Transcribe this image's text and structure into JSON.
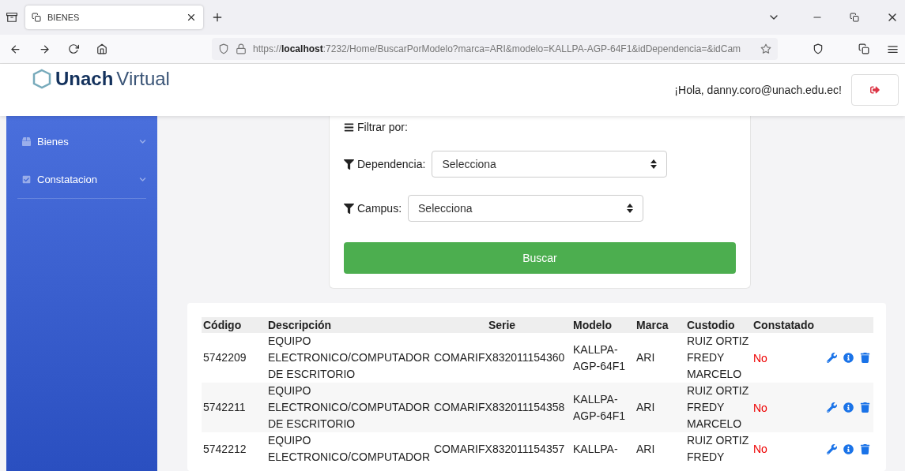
{
  "browser": {
    "tab_title": "BIENES",
    "url_scheme": "https://",
    "url_host": "localhost",
    "url_rest": ":7232/Home/BuscarPorModelo?marca=ARI&modelo=KALLPA-AGP-64F1&idDependencia=&idCam"
  },
  "header": {
    "logo_bold": "Unach",
    "logo_light": "Virtual",
    "greeting": "¡Hola, danny.coro@unach.edu.ec!"
  },
  "sidebar": {
    "items": [
      {
        "label": "Bienes",
        "kind": "box"
      },
      {
        "label": "Constatacion",
        "kind": "check"
      }
    ]
  },
  "filter": {
    "title": "Filtrar por:",
    "fields": [
      {
        "label": "Dependencia:",
        "value": "Selecciona"
      },
      {
        "label": "Campus:",
        "value": "Selecciona"
      }
    ],
    "button": "Buscar"
  },
  "table": {
    "columns": [
      "Código",
      "Descripción",
      "Serie",
      "Modelo",
      "Marca",
      "Custodio",
      "Constatado"
    ],
    "rows": [
      {
        "codigo": "5742209",
        "descripcion": "EQUIPO ELECTRONICO/COMPUTADOR DE ESCRITORIO",
        "serie": "COMARIFX832011154360",
        "modelo": "KALLPA-AGP-64F1",
        "marca": "ARI",
        "custodio": "RUIZ ORTIZ FREDY MARCELO",
        "constatado": "No"
      },
      {
        "codigo": "5742211",
        "descripcion": "EQUIPO ELECTRONICO/COMPUTADOR DE ESCRITORIO",
        "serie": "COMARIFX832011154358",
        "modelo": "KALLPA-AGP-64F1",
        "marca": "ARI",
        "custodio": "RUIZ ORTIZ FREDY MARCELO",
        "constatado": "No"
      },
      {
        "codigo": "5742212",
        "descripcion": "EQUIPO ELECTRONICO/COMPUTADOR",
        "serie": "COMARIFX832011154357",
        "modelo": "KALLPA-",
        "marca": "ARI",
        "custodio": "RUIZ ORTIZ FREDY",
        "constatado": "No"
      }
    ]
  }
}
